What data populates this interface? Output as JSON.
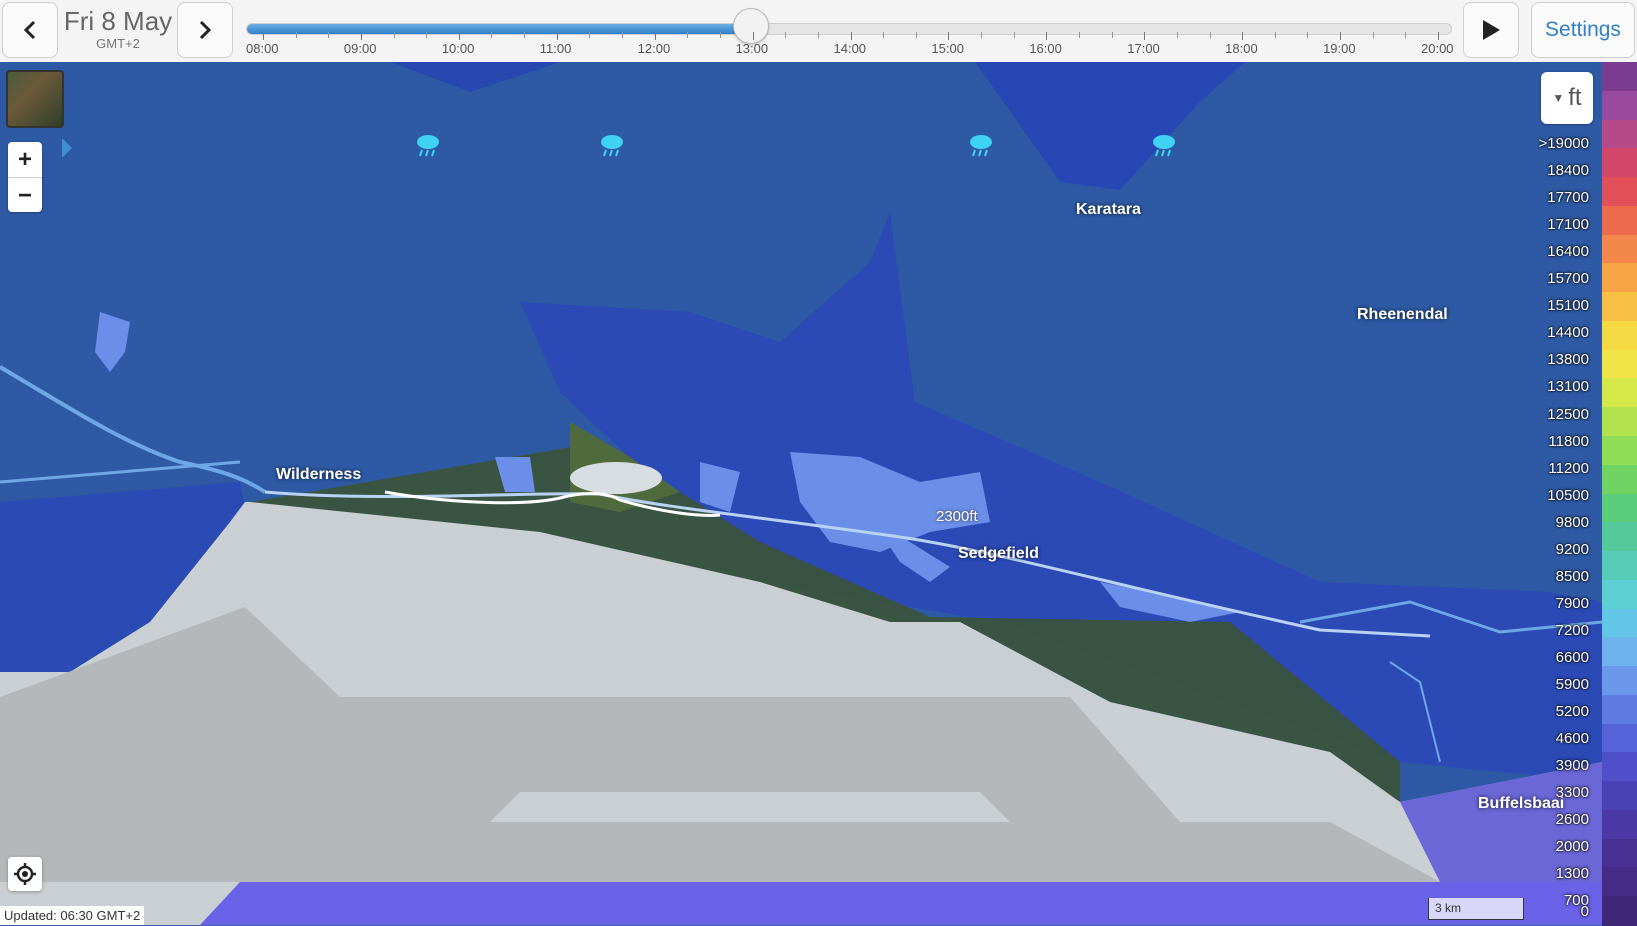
{
  "header": {
    "date": "Fri 8 May",
    "timezone": "GMT+2",
    "settings_label": "Settings",
    "prev_icon": "chevron-left-icon",
    "next_icon": "chevron-right-icon",
    "play_icon": "play-icon"
  },
  "timeline": {
    "hours": [
      "08:00",
      "09:00",
      "10:00",
      "11:00",
      "12:00",
      "13:00",
      "14:00",
      "15:00",
      "16:00",
      "17:00",
      "18:00",
      "19:00",
      "20:00"
    ],
    "current": "13:00",
    "progress": 0.4187
  },
  "map": {
    "unit": "ft",
    "places": [
      "Wilderness",
      "Karatara",
      "Rheenendal",
      "Sedgefield",
      "Buffelsbaai"
    ],
    "route_label": "2300ft",
    "weather_icon": "rain-cloud-icon",
    "scale": "3 km",
    "updated": "Updated: 06:30 GMT+2"
  },
  "legend": {
    "values": [
      ">19000",
      "18400",
      "17700",
      "17100",
      "16400",
      "15700",
      "15100",
      "14400",
      "13800",
      "13100",
      "12500",
      "11800",
      "11200",
      "10500",
      "9800",
      "9200",
      "8500",
      "7900",
      "7200",
      "6600",
      "5900",
      "5200",
      "4600",
      "3900",
      "3300",
      "2600",
      "2000",
      "1300",
      "700",
      "0"
    ],
    "colors": [
      "#7a3b8f",
      "#9a4a9e",
      "#b54a8a",
      "#d2466a",
      "#e3505a",
      "#ee6a4e",
      "#f3874a",
      "#f6a445",
      "#f7c043",
      "#f4d844",
      "#eee446",
      "#d4e84a",
      "#b2e34f",
      "#8fdc56",
      "#6fd463",
      "#5bcd7d",
      "#55c99a",
      "#56cbb8",
      "#5ccfd2",
      "#63c6e6",
      "#6db2ec",
      "#6b98ea",
      "#5f7be4",
      "#5663d8",
      "#4f4fc9",
      "#4a41b7",
      "#4a38a4",
      "#483093",
      "#452b86",
      "#3f2676"
    ]
  }
}
